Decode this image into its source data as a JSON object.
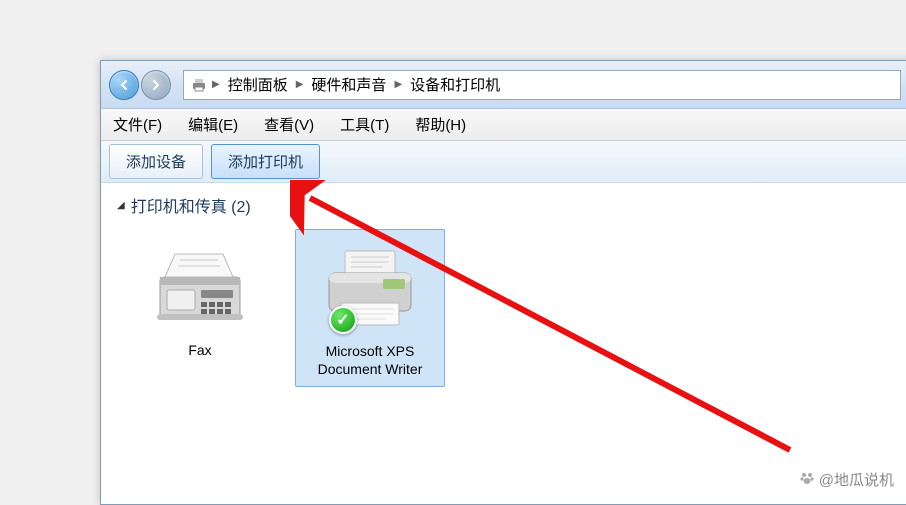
{
  "breadcrumb": {
    "items": [
      "控制面板",
      "硬件和声音",
      "设备和打印机"
    ]
  },
  "menu": {
    "file": "文件(F)",
    "edit": "编辑(E)",
    "view": "查看(V)",
    "tools": "工具(T)",
    "help": "帮助(H)"
  },
  "toolbar": {
    "add_device": "添加设备",
    "add_printer": "添加打印机"
  },
  "group": {
    "title": "打印机和传真 (2)"
  },
  "devices": [
    {
      "name": "Fax",
      "default": false
    },
    {
      "name": "Microsoft XPS Document Writer",
      "default": true
    }
  ],
  "watermark": "@地瓜说机"
}
